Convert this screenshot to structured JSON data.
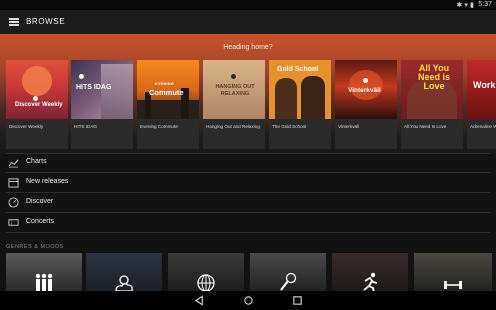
{
  "status": {
    "time": "5:37",
    "icons": [
      "bluetooth-icon",
      "wifi-icon",
      "battery-icon"
    ]
  },
  "appbar": {
    "title": "BROWSE",
    "menu_icon": "menu-icon"
  },
  "hero": {
    "heading": "Heading home?"
  },
  "playlists": [
    {
      "label": "Discover Weekly",
      "art_text": "Discover Weekly"
    },
    {
      "label": "HITS IDAG",
      "art_text": "HITS IDAG"
    },
    {
      "label": "Evening Commute",
      "art_text": "Commute",
      "art_kicker": "EVENING"
    },
    {
      "label": "Hanging Out and Relaxing",
      "art_text": "HANGING OUT RELAXING"
    },
    {
      "label": "The Gold School",
      "art_text": "Gold School"
    },
    {
      "label": "Vinterkväll",
      "art_text": "Vinterkväll"
    },
    {
      "label": "All You Need Is Love",
      "art_text": "All You Need is Love"
    },
    {
      "label": "Adrenaline Wo",
      "art_text": "Work"
    }
  ],
  "menu": [
    {
      "label": "Charts",
      "icon": "chart-icon"
    },
    {
      "label": "New releases",
      "icon": "calendar-icon"
    },
    {
      "label": "Discover",
      "icon": "compass-icon"
    },
    {
      "label": "Concerts",
      "icon": "ticket-icon"
    }
  ],
  "genres": {
    "label": "GENRES & MOODS",
    "tiles": [
      "people-icon",
      "cloud-sun-icon",
      "disco-ball-icon",
      "microphone-icon",
      "runner-icon",
      "dumbbell-icon"
    ]
  },
  "navbar": {
    "buttons": [
      "back-icon",
      "home-icon",
      "recents-icon"
    ]
  },
  "colors": {
    "hero_top": "#c9542d",
    "background": "#121212",
    "card": "#2a2a2a"
  }
}
